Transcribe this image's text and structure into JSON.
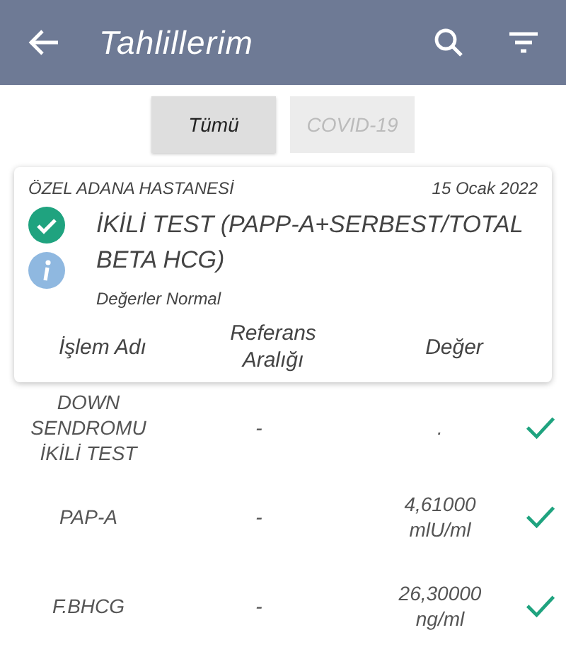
{
  "app_bar": {
    "title": "Tahlillerim"
  },
  "tabs": [
    {
      "label": "Tümü",
      "selected": true
    },
    {
      "label": "COVID-19",
      "selected": false
    }
  ],
  "card": {
    "hospital": "ÖZEL ADANA HASTANESİ",
    "date": "15 Ocak 2022",
    "test_name": "İKİLİ TEST (PAPP-A+SERBEST/TOTAL BETA HCG)",
    "status_text": "Değerler Normal",
    "columns": [
      "İşlem Adı",
      "Referans Aralığı",
      "Değer"
    ]
  },
  "rows": [
    {
      "name": "DOWN SENDROMU İKİLİ TEST",
      "reference": "-",
      "value": ".",
      "normal": true
    },
    {
      "name": "PAP-A",
      "reference": "-",
      "value": "4,61000 mlU/ml",
      "normal": true
    },
    {
      "name": "F.BHCG",
      "reference": "-",
      "value": "26,30000 ng/ml",
      "normal": true
    }
  ]
}
